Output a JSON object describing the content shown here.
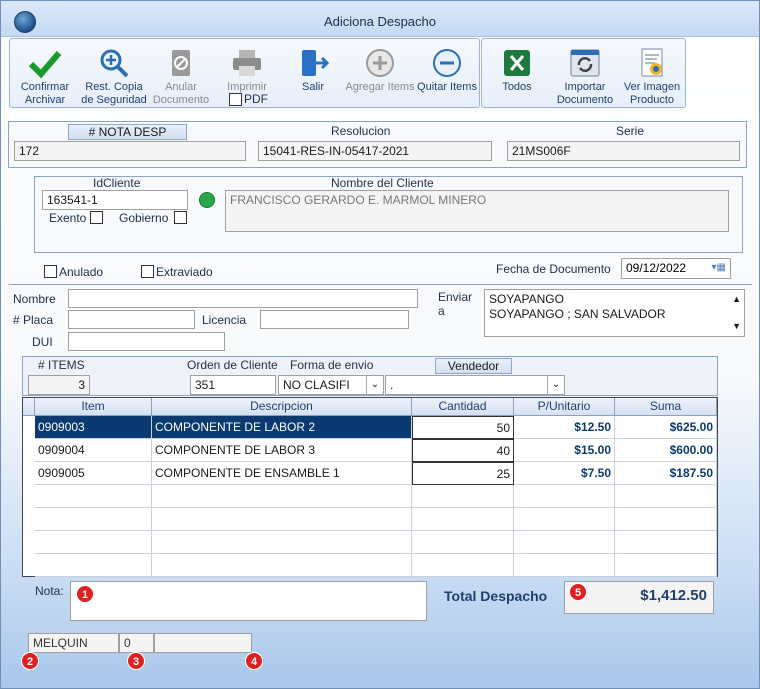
{
  "window": {
    "title": "Adiciona Despacho"
  },
  "toolbar": {
    "confirmar": "Confirmar Archivar",
    "rest_copia": "Rest. Copia de Seguridad",
    "anular": "Anular Documento",
    "imprimir": "Imprimir",
    "pdf": "PDF",
    "salir": "Salir",
    "agregar": "Agregar Items",
    "quitar": "Quitar Items",
    "todos": "Todos",
    "importar": "Importar Documento",
    "ver_imagen": "Ver Imagen Producto"
  },
  "doc": {
    "nota_label": "# NOTA DESP",
    "nota_value": "172",
    "resolucion_label": "Resolucion",
    "resolucion_value": "15041-RES-IN-05417-2021",
    "serie_label": "Serie",
    "serie_value": "21MS006F"
  },
  "cliente": {
    "id_label": "IdCliente",
    "id_value": "163541-1",
    "nombre_label": "Nombre del Cliente",
    "nombre_value": "FRANCISCO GERARDO E. MARMOL MINERO",
    "exento": "Exento",
    "gobierno": "Gobierno"
  },
  "flags": {
    "anulado": "Anulado",
    "extraviado": "Extraviado"
  },
  "fecha": {
    "label": "Fecha de Documento",
    "value": "09/12/2022"
  },
  "envio": {
    "nombre_label": "Nombre",
    "placa_label": "# Placa",
    "licencia_label": "Licencia",
    "dui_label": "DUI",
    "enviar_label": "Enviar a",
    "enviar_line1": "SOYAPANGO",
    "enviar_line2": "SOYAPANGO ; SAN SALVADOR"
  },
  "summary": {
    "items_label": "# ITEMS",
    "items_value": "3",
    "orden_label": "Orden de Cliente",
    "orden_value": "351",
    "forma_label": "Forma de envio",
    "forma_value": "NO CLASIFI",
    "vendedor_label": "Vendedor",
    "vendedor_value": "."
  },
  "table": {
    "headers": [
      "Item",
      "Descripcion",
      "Cantidad",
      "P/Unitario",
      "Suma"
    ],
    "rows": [
      {
        "item": "0909003",
        "desc": "COMPONENTE DE LABOR 2",
        "cant": "50",
        "pu": "$12.50",
        "suma": "$625.00"
      },
      {
        "item": "0909004",
        "desc": "COMPONENTE DE LABOR 3",
        "cant": "40",
        "pu": "$15.00",
        "suma": "$600.00"
      },
      {
        "item": "0909005",
        "desc": "COMPONENTE DE ENSAMBLE 1",
        "cant": "25",
        "pu": "$7.50",
        "suma": "$187.50"
      }
    ]
  },
  "footer": {
    "nota_label": "Nota:",
    "total_label": "Total Despacho",
    "total_value": "$1,412.50",
    "user": "MELQUIN",
    "zero": "0",
    "badges": [
      "1",
      "2",
      "3",
      "4",
      "5"
    ]
  },
  "colors": {
    "selected_row": "#0a3a70",
    "badge": "#e02020",
    "title_text": "#1f3f6f"
  }
}
